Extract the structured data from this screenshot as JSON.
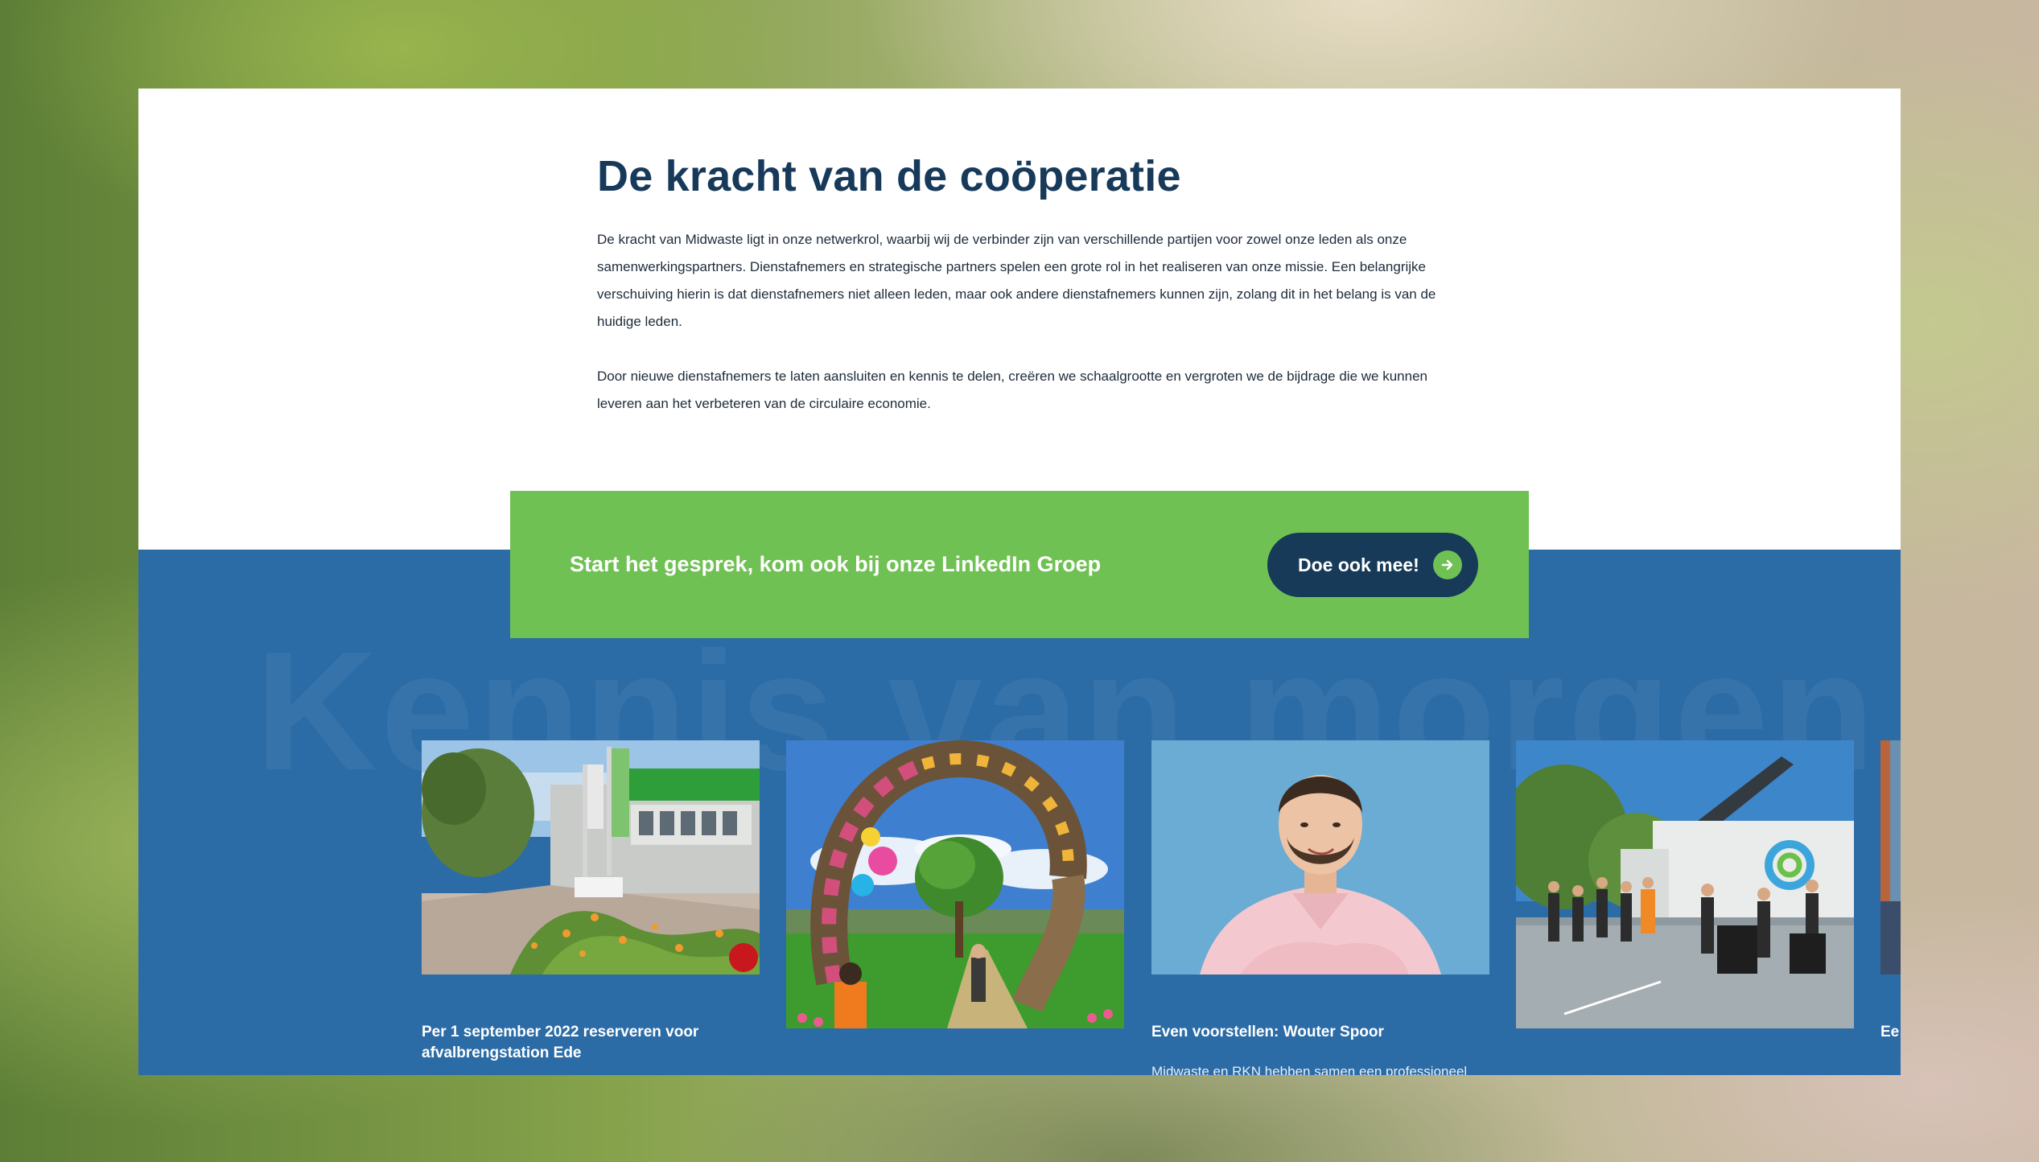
{
  "intro": {
    "heading": "De kracht van de coöperatie",
    "paragraph_1": "De kracht van Midwaste ligt in onze netwerkrol, waarbij wij de verbinder zijn van verschillende partijen voor zowel onze leden als onze samenwerkingspartners. Dienstafnemers en strategische partners spelen een grote rol in het realiseren van onze missie. Een belangrijke verschuiving hierin is dat dienstafnemers niet alleen leden, maar ook andere dienstafnemers kunnen zijn, zolang dit in het belang is van de huidige leden.",
    "paragraph_2": "Door nieuwe dienstafnemers te laten aansluiten en kennis te delen, creëren we schaalgrootte en vergroten we de bijdrage die we kunnen leveren aan het verbeteren van de circulaire economie."
  },
  "cta": {
    "text": "Start het gesprek, kom ook bij onze LinkedIn Groep",
    "button_label": "Doe ook mee!",
    "button_icon": "arrow-right-icon"
  },
  "knowledge": {
    "background_heading": "Kennis van morgen",
    "cards": [
      {
        "title": "Per 1 september 2022 reserveren voor afvalbrengstation Ede",
        "excerpt": "",
        "image": "recycling-station-building-with-flowers"
      },
      {
        "title": "",
        "excerpt": "",
        "image": "colorful-recycled-art-arch"
      },
      {
        "title": "Even voorstellen: Wouter Spoor",
        "excerpt": "Midwaste en RKN hebben samen een professioneel",
        "image": "portrait-man-pink-shirt"
      },
      {
        "title": "",
        "excerpt": "",
        "image": "event-crowd-with-truck"
      },
      {
        "title": "Ee va",
        "excerpt": "",
        "image": "partial-landscape"
      }
    ]
  },
  "colors": {
    "navy": "#17395a",
    "green": "#70c154",
    "blue": "#2c6ca6",
    "button": "#163a58"
  }
}
